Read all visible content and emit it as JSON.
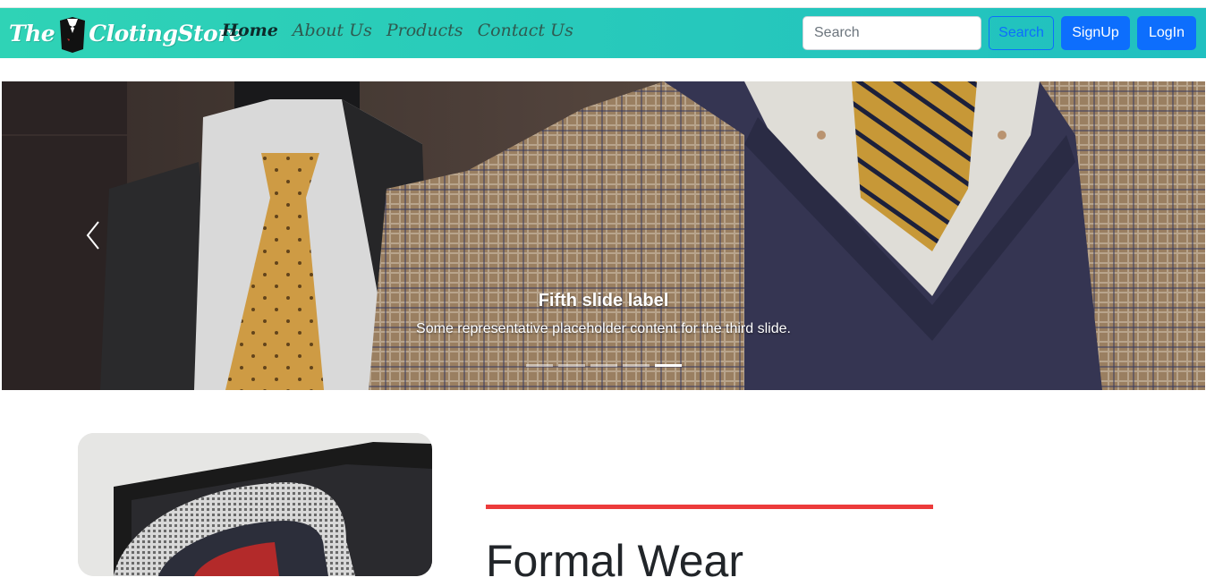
{
  "brand": {
    "name": "The ClotingStore",
    "first_word": "The",
    "rest": "ClotingStore"
  },
  "nav": {
    "links": [
      {
        "label": "Home",
        "active": true
      },
      {
        "label": "About Us",
        "active": false
      },
      {
        "label": "Products",
        "active": false
      },
      {
        "label": "Contact Us",
        "active": false
      }
    ]
  },
  "search": {
    "placeholder": "Search",
    "button_label": "Search"
  },
  "auth": {
    "signup_label": "SignUp",
    "login_label": "LogIn"
  },
  "carousel": {
    "caption_title": "Fifth slide label",
    "caption_text": "Some representative placeholder content for the third slide.",
    "indicator_count": 5,
    "active_index": 4
  },
  "section": {
    "heading": "Formal Wear"
  },
  "colors": {
    "navbar_start": "#2fd3b6",
    "navbar_end": "#20c0c0",
    "primary": "#0d6efd",
    "accent_line": "#ec3b3b"
  }
}
